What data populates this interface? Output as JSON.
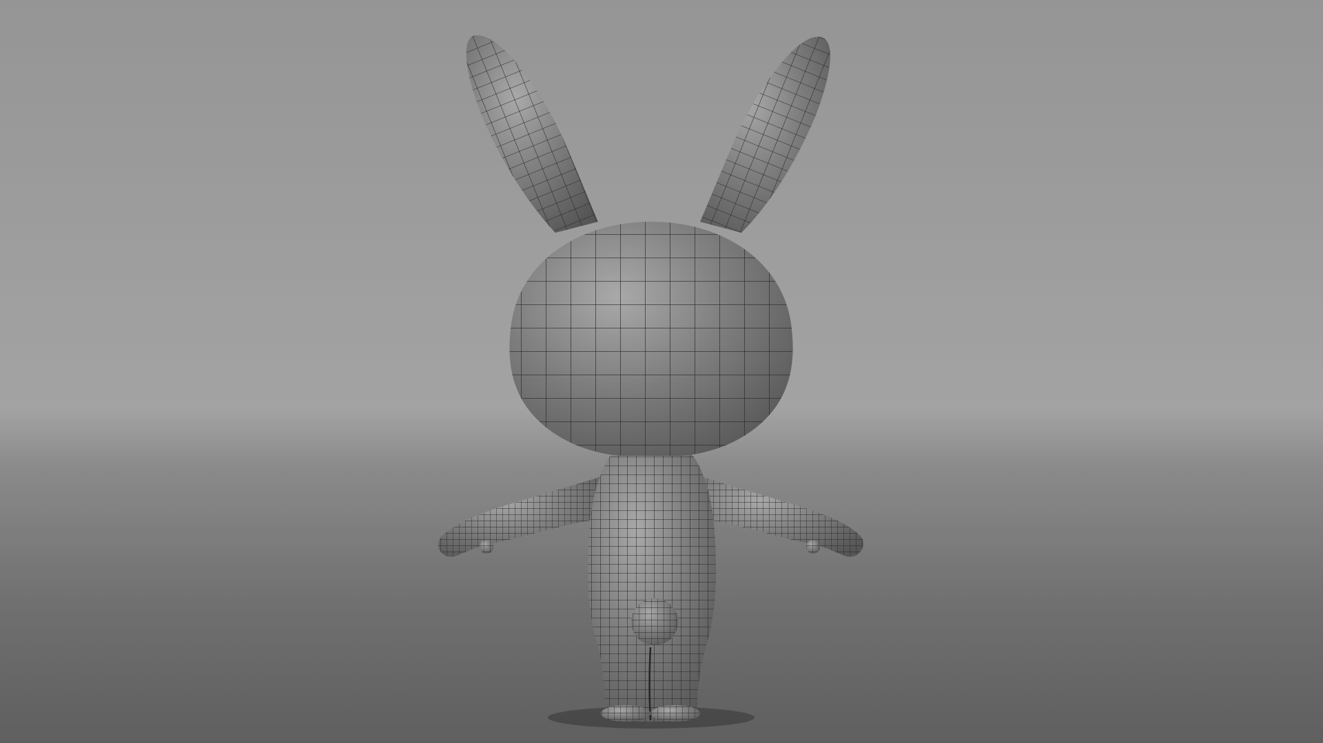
{
  "viewport": {
    "subject": "bunny-wireframe-model-back-view",
    "colors": {
      "top_strip": "#e8a3a3",
      "backdrop_top": "#959595",
      "backdrop_mid": "#a3a3a3",
      "horizon": "#8a8a8a",
      "floor": "#6f6f6f",
      "floor_bottom": "#5f5f5f",
      "mesh_fill": "#7d7d7d",
      "mesh_highlight": "#a9a9a9",
      "mesh_shadow": "#565656",
      "wire": "#262626"
    }
  }
}
